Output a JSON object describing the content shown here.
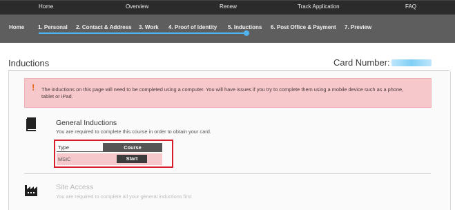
{
  "topnav": {
    "items": [
      "Home",
      "Overview",
      "Renew",
      "Track Application",
      "FAQ"
    ]
  },
  "steps": {
    "items": [
      "Home",
      "1. Personal",
      "2. Contact & Address",
      "3. Work",
      "4. Proof of Identity",
      "5. Inductions",
      "6. Post Office & Payment",
      "7. Preview"
    ],
    "active_step": "5. Inductions",
    "accent_color": "#4fb3f0"
  },
  "header": {
    "title": "Inductions",
    "card_number_label": "Card Number:"
  },
  "alert": {
    "icon": "exclamation-icon",
    "text": "The inductions on this page will need to be completed using a computer. You will have issues if you try to complete them using a mobile device such as a phone, tablet or iPad.",
    "background": "#f6c7cb"
  },
  "general_inductions": {
    "icon": "book-icon",
    "title": "General Inductions",
    "description": "You are required to complete this course in order to obtain your card.",
    "table": {
      "headers": [
        "Type",
        "Course"
      ],
      "rows": [
        {
          "type": "MSIC",
          "action": "Start"
        }
      ]
    },
    "highlight_color": "#d81c2a"
  },
  "site_access": {
    "icon": "factory-icon",
    "title": "Site Access",
    "description": "You are required to complete all your general inductions first"
  }
}
